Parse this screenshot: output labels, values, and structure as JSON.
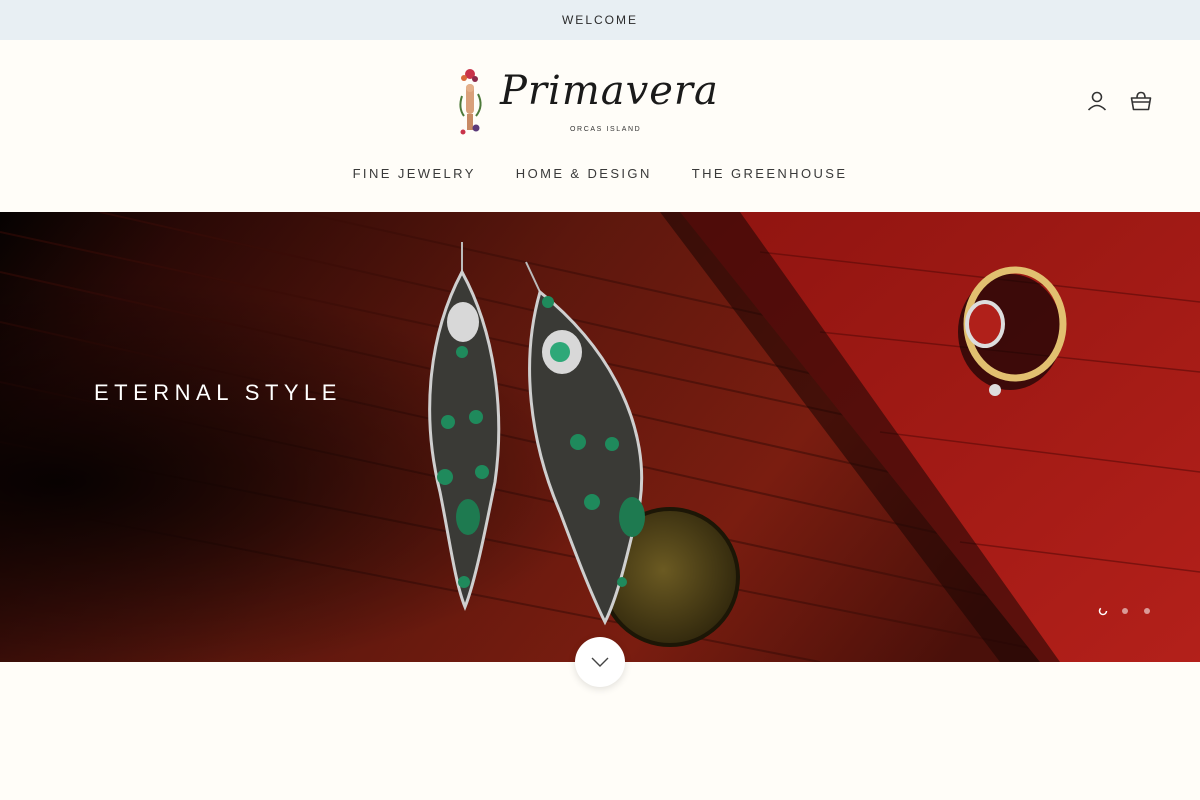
{
  "announcement": {
    "text": "WELCOME"
  },
  "brand": {
    "name": "Primavera",
    "tagline": "ORCAS ISLAND"
  },
  "header": {
    "icons": [
      "account-icon",
      "cart-icon"
    ]
  },
  "nav": {
    "items": [
      {
        "label": "FINE JEWELRY"
      },
      {
        "label": "HOME & DESIGN"
      },
      {
        "label": "THE GREENHOUSE"
      }
    ]
  },
  "hero": {
    "title": "ETERNAL STYLE",
    "slides": {
      "count": 3,
      "active": 1
    }
  },
  "scroll": {
    "icon": "chevron-down-icon"
  },
  "colors": {
    "announce_bg": "#e8eff3",
    "page_bg": "#fffdf8",
    "hero_wood": "#6b1a0f",
    "emerald": "#1f8a5c"
  }
}
